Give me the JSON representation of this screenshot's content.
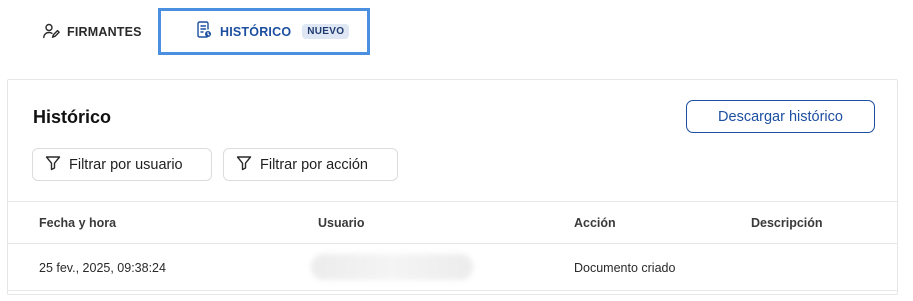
{
  "tabs": {
    "firmantes_label": "FIRMANTES",
    "historico_label": "HISTÓRICO",
    "historico_badge": "NUEVO"
  },
  "panel": {
    "title": "Histórico",
    "download_label": "Descargar histórico",
    "filter_user_label": "Filtrar por usuario",
    "filter_action_label": "Filtrar por acción"
  },
  "table": {
    "headers": [
      "Fecha y hora",
      "Usuario",
      "Acción",
      "Descripción"
    ],
    "rows": [
      {
        "fecha": "25 fev., 2025, 09:38:24",
        "usuario": "",
        "accion": "Documento criado",
        "descripcion": ""
      }
    ]
  },
  "colors": {
    "accent": "#1c4fa0",
    "focus_outline": "#4a8fe0"
  }
}
